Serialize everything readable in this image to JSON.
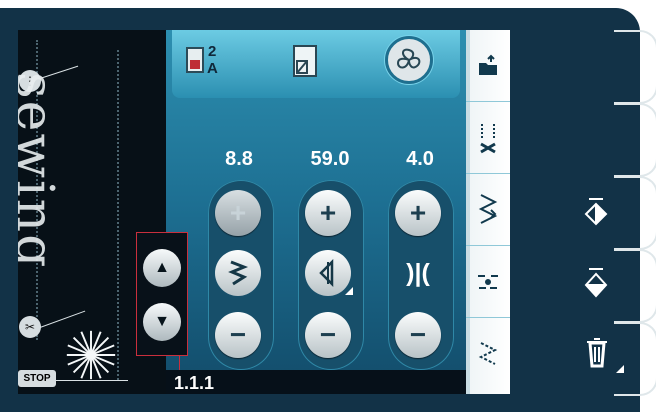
{
  "stitch_preview": {
    "text": "sewing"
  },
  "controls": {
    "values": [
      "8.8",
      "59.0",
      "4.0"
    ],
    "plus": "+",
    "minus": "−",
    "mirror_symbol": ")|("
  },
  "status": {
    "label": "1.1.1"
  },
  "top": {
    "screen_number": "2",
    "screen_letter": "A"
  },
  "left_panel": {
    "stop_label": "STOP"
  },
  "colors": {
    "accent": "#2d8fb0",
    "panel_dark": "#123247",
    "highlight_red": "#c92f3d"
  }
}
